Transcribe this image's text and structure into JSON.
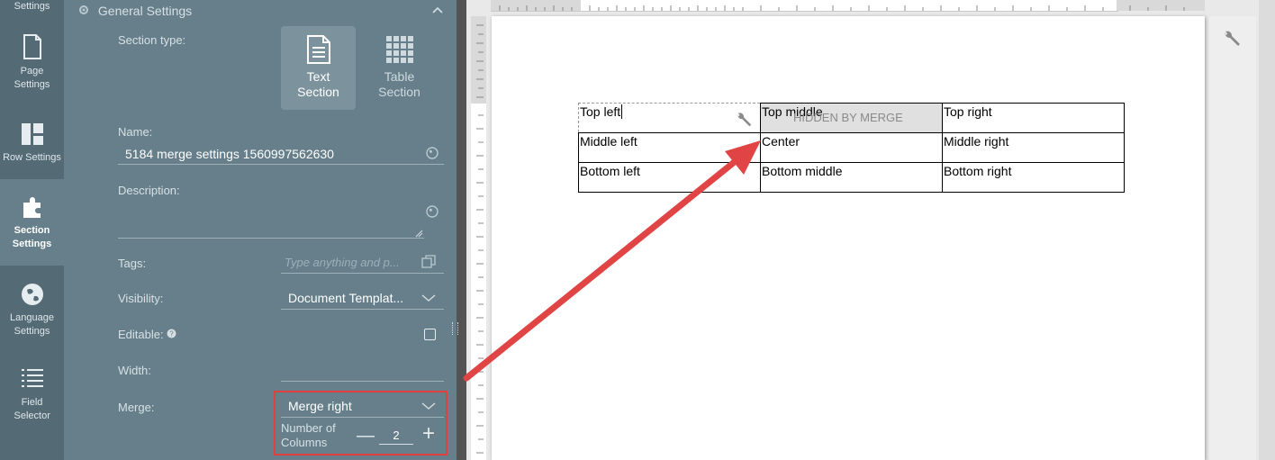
{
  "left_nav": {
    "items": [
      {
        "label": "Settings",
        "icon": "settings-icon"
      },
      {
        "label": "Page Settings",
        "icon": "page-icon"
      },
      {
        "label": "Row Settings",
        "icon": "row-layout-icon"
      },
      {
        "label": "Section Settings",
        "icon": "puzzle-icon"
      },
      {
        "label": "Language Settings",
        "icon": "globe-icon"
      },
      {
        "label": "Field Selector",
        "icon": "list-icon"
      }
    ]
  },
  "panel": {
    "header": "General Settings",
    "section_type": {
      "label": "Section type:",
      "options": [
        "Text Section",
        "Table Section"
      ],
      "selected": "Text Section"
    },
    "name": {
      "label": "Name:",
      "value": "5184 merge settings 1560997562630"
    },
    "description": {
      "label": "Description:",
      "value": ""
    },
    "tags": {
      "label": "Tags:",
      "placeholder": "Type anything and p..."
    },
    "visibility": {
      "label": "Visibility:",
      "value": "Document Templat..."
    },
    "editable": {
      "label": "Editable:",
      "checked": false
    },
    "width": {
      "label": "Width:",
      "value": ""
    },
    "merge": {
      "label": "Merge:",
      "value": "Merge right",
      "columns_label": "Number of Columns",
      "columns": "2"
    }
  },
  "document": {
    "rows": [
      [
        "Top left",
        "Top middle",
        "Top right"
      ],
      [
        "Middle left",
        "Center",
        "Middle right"
      ],
      [
        "Bottom left",
        "Bottom middle",
        "Bottom right"
      ]
    ],
    "hidden_label": "HIDDEN BY MERGE"
  },
  "colors": {
    "sidebar": "#546b75",
    "panel": "#667f8a",
    "highlight": "#e04040"
  }
}
